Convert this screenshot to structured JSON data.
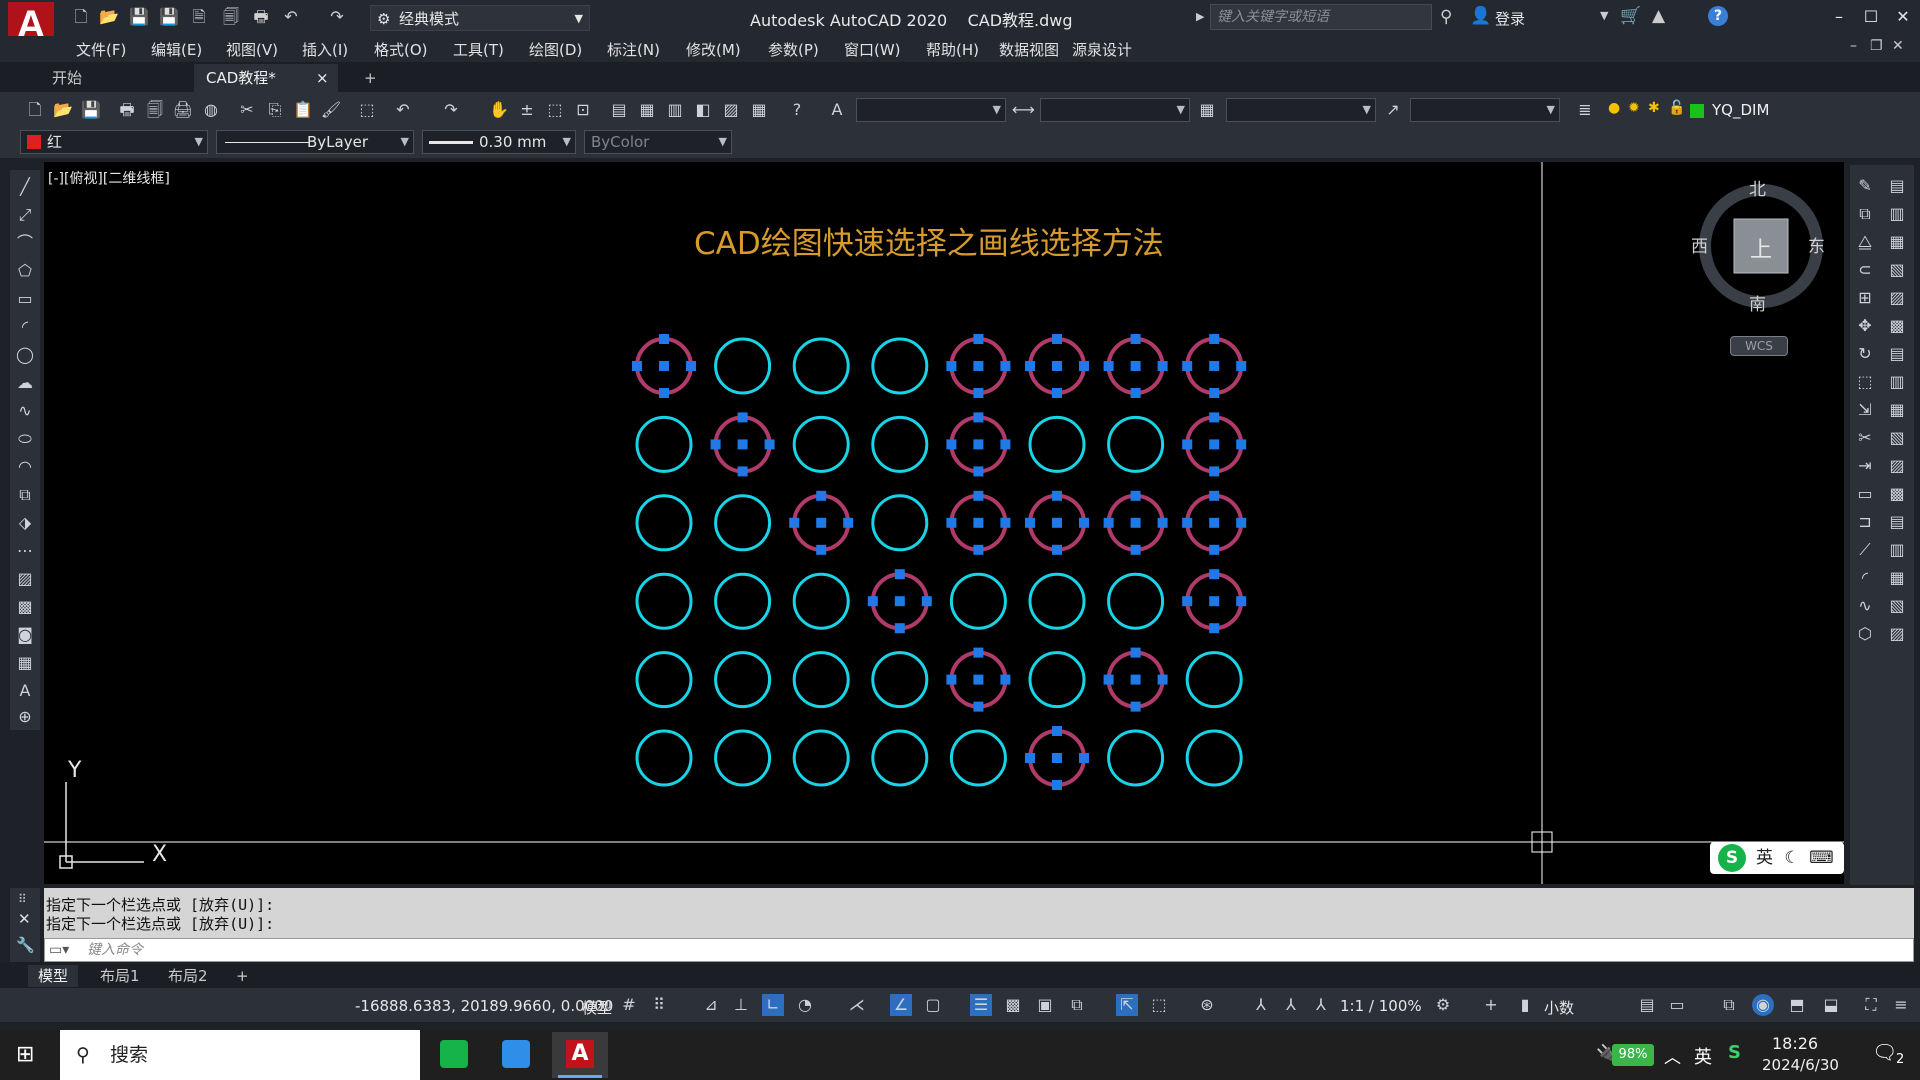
{
  "titlebar": {
    "workspace": "经典模式",
    "app_title": "Autodesk AutoCAD 2020",
    "file_name": "CAD教程.dwg",
    "search_placeholder": "键入关键字或短语",
    "login_label": "登录",
    "help_label": "?"
  },
  "menu": [
    "文件(F)",
    "编辑(E)",
    "视图(V)",
    "插入(I)",
    "格式(O)",
    "工具(T)",
    "绘图(D)",
    "标注(N)",
    "修改(M)",
    "参数(P)",
    "窗口(W)",
    "帮助(H)",
    "数据视图",
    "源泉设计"
  ],
  "tabs": {
    "start": "开始",
    "active": "CAD教程*",
    "close": "×",
    "add": "+"
  },
  "properties": {
    "color": "红",
    "color_hex": "#e02020",
    "linetype": "ByLayer",
    "lineweight": "0.30 mm",
    "plotstyle": "ByColor",
    "layer": "YQ_DIM",
    "layer_color_hex": "#19c219"
  },
  "canvas": {
    "view_label": "[-][俯视][二维线框]",
    "drawing_title": "CAD绘图快速选择之画线选择方法",
    "title_color": "#d79a2f",
    "circle_color": "#19d4e6",
    "selected_color": "#b03a6a",
    "grip_color": "#1f7ae8",
    "compass": {
      "north": "北",
      "south": "南",
      "west": "西",
      "east": "东",
      "top": "上",
      "wcs": "WCS"
    },
    "ucs": {
      "y": "Y",
      "x": "X"
    },
    "grid": {
      "rows": [
        [
          1,
          0,
          0,
          0,
          1,
          1,
          1,
          1
        ],
        [
          0,
          1,
          0,
          0,
          1,
          0,
          0,
          1
        ],
        [
          0,
          0,
          1,
          0,
          1,
          1,
          1,
          1
        ],
        [
          0,
          0,
          0,
          1,
          0,
          0,
          0,
          1
        ],
        [
          0,
          0,
          0,
          0,
          1,
          0,
          1,
          0
        ],
        [
          0,
          0,
          0,
          0,
          0,
          1,
          0,
          0
        ]
      ]
    },
    "ime": "英"
  },
  "command": {
    "history": [
      "指定下一个栏选点或 [放弃(U)]:",
      "指定下一个栏选点或 [放弃(U)]:"
    ],
    "input_placeholder": "键入命令"
  },
  "layout_tabs": [
    "模型",
    "布局1",
    "布局2",
    "+"
  ],
  "status": {
    "coords": "-16888.6383, 20189.9660, 0.0000",
    "model": "模型",
    "scale": "1:1 / 100%",
    "units": "小数"
  },
  "taskbar": {
    "search": "搜索",
    "battery": "98%",
    "ime": "英",
    "time": "18:26",
    "date": "2024/6/30",
    "notifications": "2"
  }
}
